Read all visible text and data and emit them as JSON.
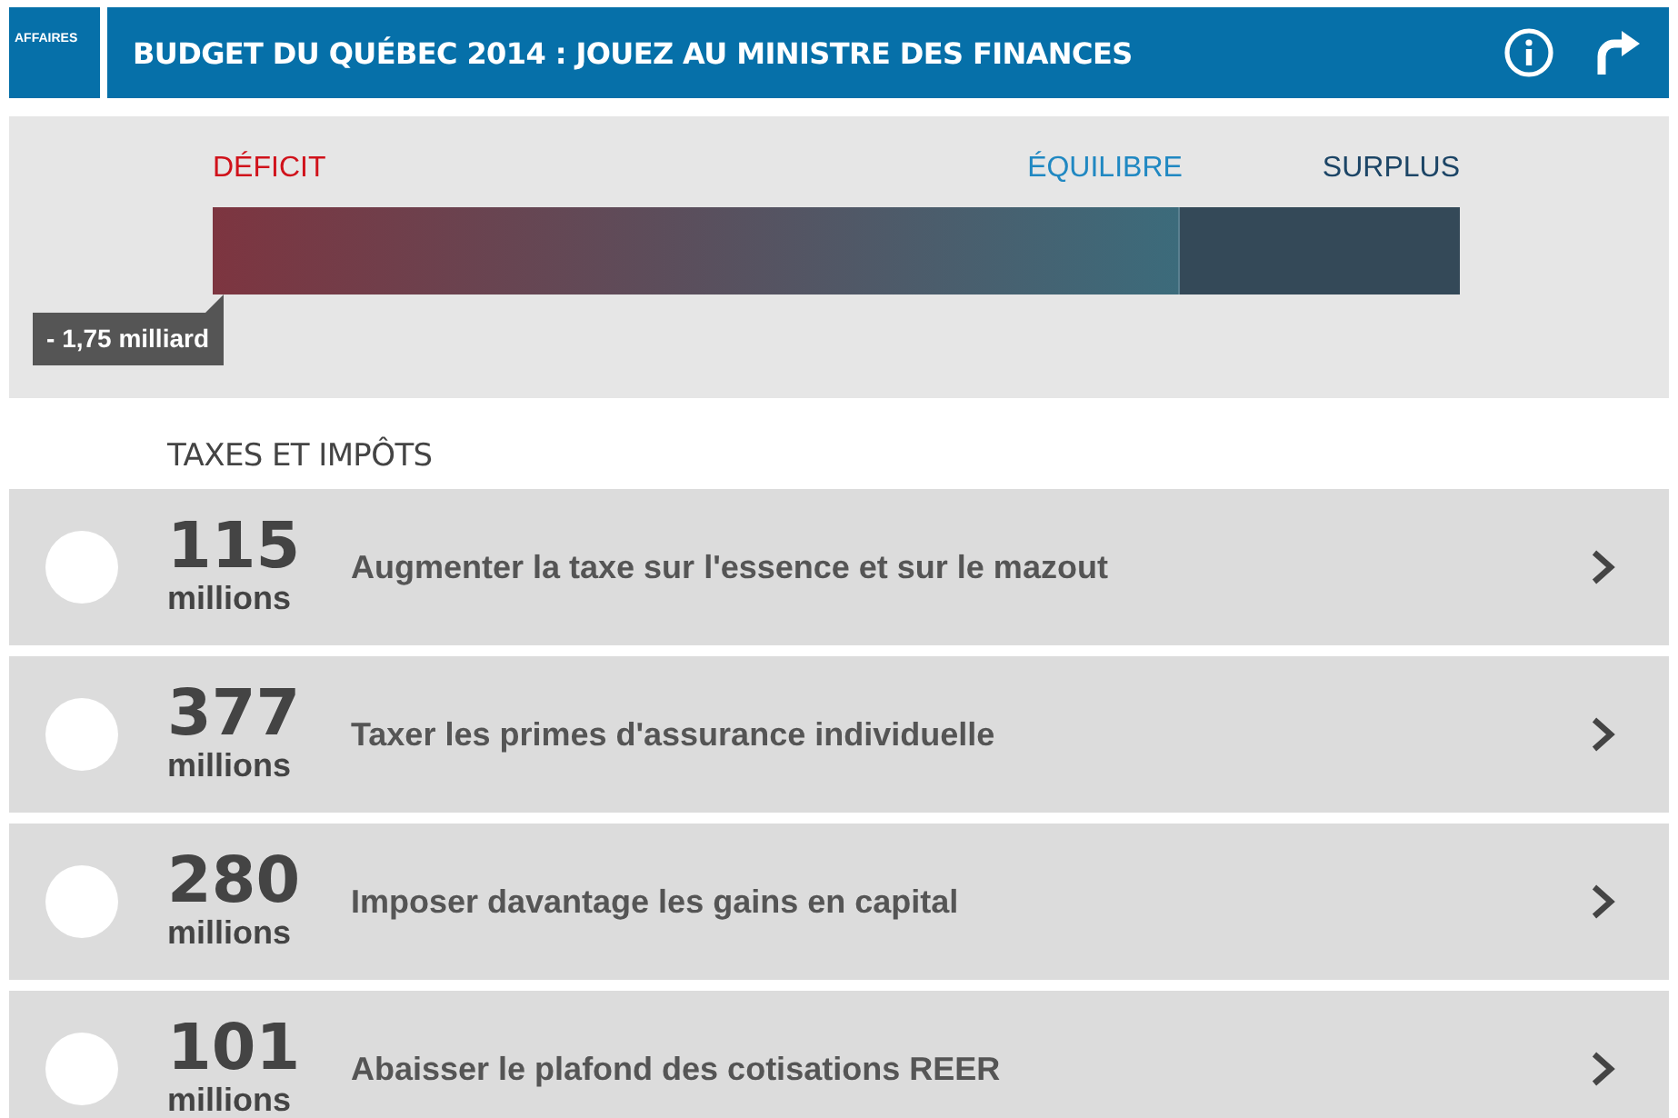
{
  "header": {
    "section": "AFFAIRES",
    "title": "BUDGET DU QUÉBEC 2014 : JOUEZ AU MINISTRE DES FINANCES"
  },
  "meter": {
    "labels": [
      {
        "text": "DÉFICIT",
        "kind": "deficit"
      },
      {
        "text": "ÉQUILIBRE",
        "kind": "balance"
      },
      {
        "text": "SURPLUS",
        "kind": "surplus"
      }
    ],
    "reading": "- 1,75 milliard"
  },
  "section": {
    "title": "TAXES ET IMPÔTS"
  },
  "measures": [
    {
      "amount": "115",
      "unit": "millions",
      "label": "Augmenter la taxe sur l'essence et sur le mazout",
      "selected": false
    },
    {
      "amount": "377",
      "unit": "millions",
      "label": "Taxer les primes d'assurance individuelle",
      "selected": false
    },
    {
      "amount": "280",
      "unit": "millions",
      "label": "Imposer davantage les gains en capital",
      "selected": false
    },
    {
      "amount": "101",
      "unit": "millions",
      "label": "Abaisser le plafond des cotisations REER",
      "selected": false
    }
  ]
}
